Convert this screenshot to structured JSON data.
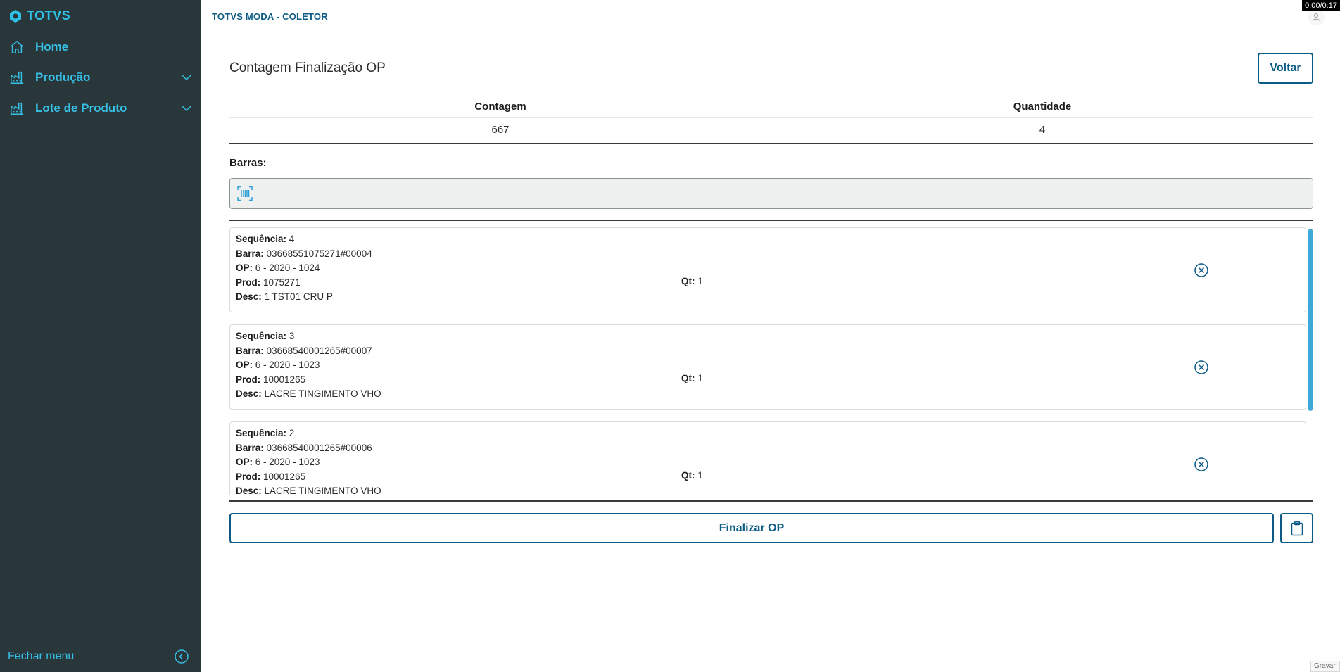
{
  "sidebar": {
    "logo": "TOTVS",
    "items": [
      {
        "label": "Home",
        "icon": "home-icon"
      },
      {
        "label": "Produção",
        "icon": "factory-icon"
      },
      {
        "label": "Lote de Produto",
        "icon": "factory-icon"
      }
    ],
    "close_label": "Fechar menu"
  },
  "header": {
    "app_title": "TOTVS MODA - COLETOR",
    "timer": "0:00/0:17"
  },
  "page": {
    "title": "Contagem Finalização OP",
    "back_label": "Voltar"
  },
  "summary": {
    "headers": [
      "Contagem",
      "Quantidade"
    ],
    "values": [
      "667",
      "4"
    ]
  },
  "barras": {
    "label": "Barras:",
    "value": ""
  },
  "field_labels": {
    "sequencia": "Sequência:",
    "barra": "Barra:",
    "op": "OP:",
    "prod": "Prod:",
    "desc": "Desc:",
    "qt": "Qt:"
  },
  "items": [
    {
      "sequencia": "4",
      "barra": "03668551075271#00004",
      "op": "6 - 2020 - 1024",
      "prod": "1075271",
      "desc": "1 TST01 CRU P",
      "qt": "1"
    },
    {
      "sequencia": "3",
      "barra": "03668540001265#00007",
      "op": "6 - 2020 - 1023",
      "prod": "10001265",
      "desc": "LACRE TINGIMENTO VHO",
      "qt": "1"
    },
    {
      "sequencia": "2",
      "barra": "03668540001265#00006",
      "op": "6 - 2020 - 1023",
      "prod": "10001265",
      "desc": "LACRE TINGIMENTO VHO",
      "qt": "1"
    }
  ],
  "actions": {
    "finalize_label": "Finalizar OP",
    "clipboard_icon": "clipboard-icon"
  },
  "overlay": {
    "gravar": "Gravar"
  },
  "colors": {
    "sidebar_bg": "#29363a",
    "accent": "#37c0e6",
    "primary": "#0c5b86"
  }
}
